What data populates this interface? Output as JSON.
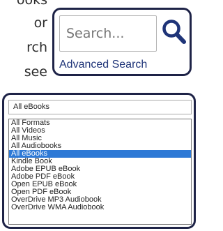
{
  "background_text": {
    "lines": [
      "ooks",
      "or",
      "rch",
      "see"
    ]
  },
  "search": {
    "placeholder": "Search...",
    "button_icon": "search-icon",
    "advanced_link": "Advanced Search"
  },
  "format_select": {
    "selected": "All eBooks",
    "options": [
      "All Formats",
      "All Videos",
      "All Music",
      "All Audiobooks",
      "All eBooks",
      "Kindle Book",
      "Adobe EPUB eBook",
      "Adobe PDF eBook",
      "Open EPUB eBook",
      "Open PDF eBook",
      "OverDrive MP3 Audiobook",
      "OverDrive WMA Audiobook"
    ],
    "highlighted_index": 4
  },
  "colors": {
    "frame_border": "#1e2347",
    "link": "#1f3478",
    "icon": "#1f3478",
    "selection": "#2d79d6"
  }
}
